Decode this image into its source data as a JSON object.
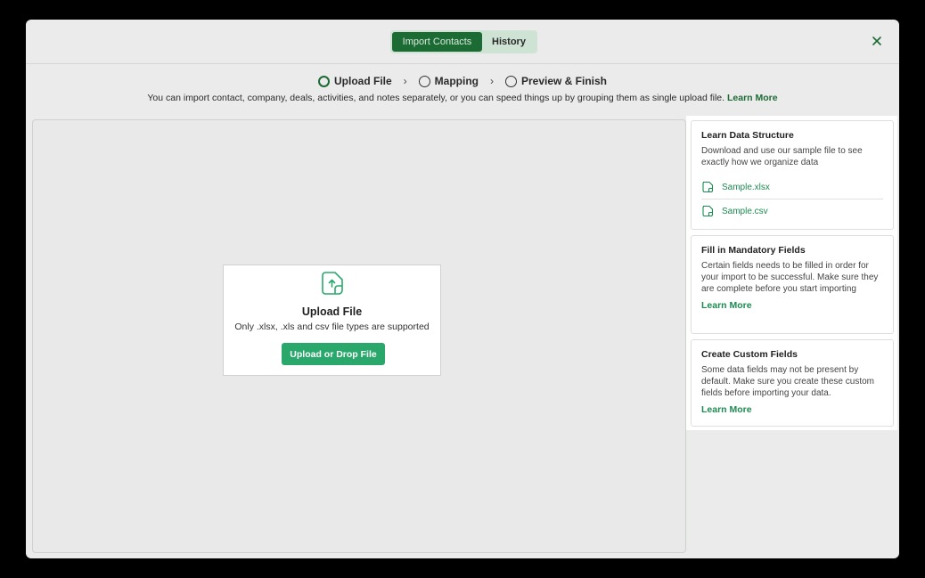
{
  "header": {
    "tabs": [
      {
        "label": "Import Contacts",
        "active": true
      },
      {
        "label": "History",
        "active": false
      }
    ],
    "close_icon": "close-icon"
  },
  "steps": [
    {
      "label": "Upload File",
      "active": true
    },
    {
      "label": "Mapping",
      "active": false
    },
    {
      "label": "Preview & Finish",
      "active": false
    }
  ],
  "description": {
    "text": "You can import contact, company, deals, activities, and notes separately, or you can speed things up by grouping them as single upload file.",
    "link": "Learn More"
  },
  "upload": {
    "icon": "file-upload-icon",
    "title": "Upload File",
    "subtitle": "Only .xlsx, .xls and csv file types are supported",
    "button": "Upload or Drop File"
  },
  "sidebar": {
    "learn_data": {
      "title": "Learn Data Structure",
      "text": "Download and use our sample file to see exactly how we organize  data",
      "files": [
        "Sample.xlsx",
        "Sample.csv"
      ]
    },
    "mandatory": {
      "title": "Fill in Mandatory Fields",
      "text": "Certain fields needs to be filled in order for your import to be successful. Make sure they are complete before you start importing",
      "link": "Learn More"
    },
    "custom": {
      "title": "Create Custom Fields",
      "text": "Some data fields may not be present by default. Make sure you create these custom fields before importing your data.",
      "link": "Learn More"
    }
  },
  "colors": {
    "accent": "#1d6b34",
    "button": "#2aa86c",
    "link": "#1d8a52"
  }
}
